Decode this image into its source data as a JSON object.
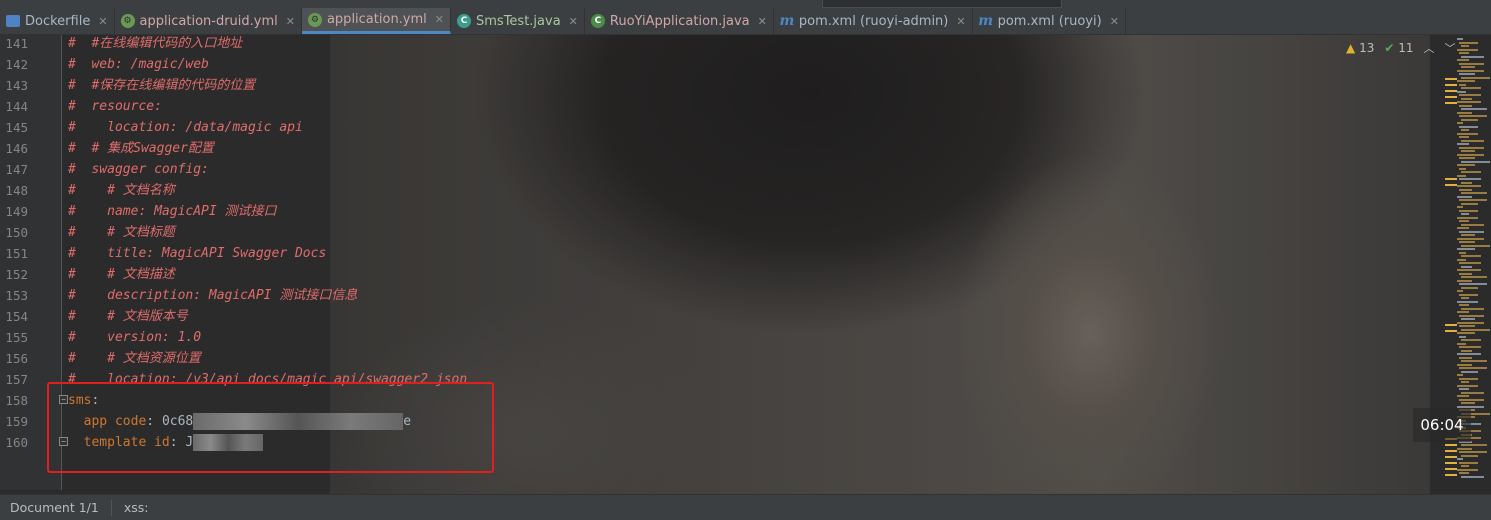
{
  "tabs": [
    {
      "label": "Dockerfile",
      "icon": "docker-icon",
      "active": false
    },
    {
      "label": "application-druid.yml",
      "icon": "yml-icon",
      "active": false
    },
    {
      "label": "application.yml",
      "icon": "yml-icon",
      "active": true
    },
    {
      "label": "SmsTest.java",
      "icon": "java-test-icon",
      "active": false
    },
    {
      "label": "RuoYiApplication.java",
      "icon": "spring-icon",
      "active": false
    },
    {
      "label": "pom.xml (ruoyi-admin)",
      "icon": "maven-icon",
      "active": false
    },
    {
      "label": "pom.xml (ruoyi)",
      "icon": "maven-icon",
      "active": false
    }
  ],
  "editor": {
    "lines": [
      {
        "num": "141",
        "text": "#  #在线编辑代码的入口地址"
      },
      {
        "num": "142",
        "text": "#  web: /magic/web"
      },
      {
        "num": "143",
        "text": "#  #保存在线编辑的代码的位置"
      },
      {
        "num": "144",
        "text": "#  resource:"
      },
      {
        "num": "145",
        "text": "#    location: /data/magic api"
      },
      {
        "num": "146",
        "text": "#  # 集成Swagger配置"
      },
      {
        "num": "147",
        "text": "#  swagger config:"
      },
      {
        "num": "148",
        "text": "#    # 文档名称"
      },
      {
        "num": "149",
        "text": "#    name: MagicAPI 测试接口"
      },
      {
        "num": "150",
        "text": "#    # 文档标题"
      },
      {
        "num": "151",
        "text": "#    title: MagicAPI Swagger Docs"
      },
      {
        "num": "152",
        "text": "#    # 文档描述"
      },
      {
        "num": "153",
        "text": "#    description: MagicAPI 测试接口信息"
      },
      {
        "num": "154",
        "text": "#    # 文档版本号"
      },
      {
        "num": "155",
        "text": "#    version: 1.0"
      },
      {
        "num": "156",
        "text": "#    # 文档资源位置"
      },
      {
        "num": "157",
        "text": "#    location: /v3/api docs/magic api/swagger2 json"
      }
    ],
    "sms_lines": [
      {
        "num": "158",
        "key": "sms",
        "sep": ":",
        "value": ""
      },
      {
        "num": "159",
        "key": "  app code",
        "sep": ": ",
        "value": "0c68",
        "tail": "e"
      },
      {
        "num": "160",
        "key": "  template id",
        "sep": ": ",
        "value": "J"
      }
    ]
  },
  "indicators": {
    "warnings": "13",
    "checks": "11"
  },
  "timer": "06:04",
  "status": {
    "document": "Document 1/1",
    "path": "xss:"
  },
  "colors": {
    "highlight_box": "#e02020",
    "accent": "#4a88c7"
  }
}
